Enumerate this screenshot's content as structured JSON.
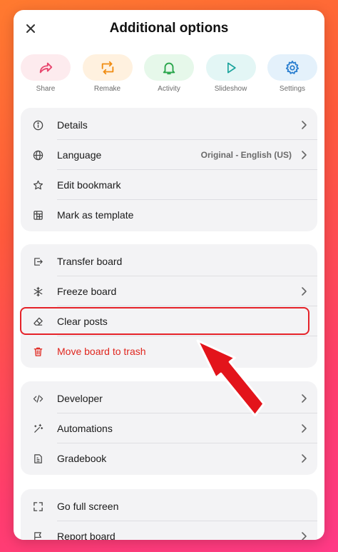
{
  "dialog": {
    "title": "Additional options"
  },
  "actions": [
    {
      "label": "Share",
      "icon": "share-icon",
      "bg": "#fdebee",
      "color": "#e8466e"
    },
    {
      "label": "Remake",
      "icon": "remake-icon",
      "bg": "#fff1df",
      "color": "#f08c12"
    },
    {
      "label": "Activity",
      "icon": "bell-icon",
      "bg": "#e6f8ea",
      "color": "#27a54a"
    },
    {
      "label": "Slideshow",
      "icon": "play-icon",
      "bg": "#e3f6f5",
      "color": "#1aa39c"
    },
    {
      "label": "Settings",
      "icon": "gear-icon",
      "bg": "#e4f1fb",
      "color": "#2b7fd0"
    }
  ],
  "group1": {
    "details": "Details",
    "language": "Language",
    "language_value": "Original - English (US)",
    "edit_bookmark": "Edit bookmark",
    "mark_template": "Mark as template"
  },
  "group2": {
    "transfer": "Transfer board",
    "freeze": "Freeze board",
    "clear": "Clear posts",
    "trash": "Move board to trash"
  },
  "group3": {
    "developer": "Developer",
    "automations": "Automations",
    "gradebook": "Gradebook"
  },
  "group4": {
    "fullscreen": "Go full screen",
    "report": "Report board"
  },
  "colors": {
    "danger": "#e0271f",
    "highlight": "#e52229",
    "arrow": "#e3141b"
  }
}
